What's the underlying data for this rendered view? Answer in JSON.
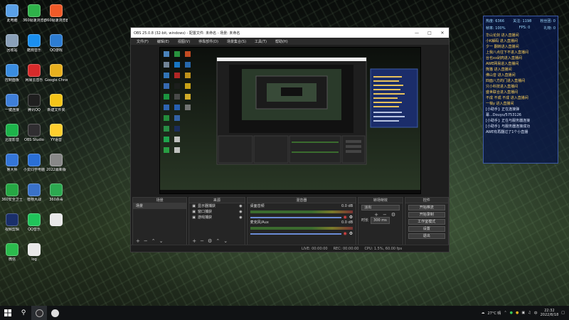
{
  "desktop": {
    "icons": [
      {
        "label": "此电脑",
        "color": "#5aa0e6"
      },
      {
        "label": "360极速浏览器",
        "color": "#2fb34a"
      },
      {
        "label": "360极速浏览器",
        "color": "#f05a28"
      },
      {
        "label": "回收站",
        "color": "#8aa0b8"
      },
      {
        "label": "酷狗音乐",
        "color": "#1a8ff0"
      },
      {
        "label": "QQ游戏",
        "color": "#2d7dd2"
      },
      {
        "label": "控制面板",
        "color": "#3a8de0"
      },
      {
        "label": "网易云音乐",
        "color": "#d82b2b"
      },
      {
        "label": "Google Chrome",
        "color": "#e8b01e"
      },
      {
        "label": "一键连接",
        "color": "#3f7fd8"
      },
      {
        "label": "腾讯QQ",
        "color": "#1f1f1f"
      },
      {
        "label": "新建文件夹",
        "color": "#f5c518"
      },
      {
        "label": "迅雷影音",
        "color": "#1db34a"
      },
      {
        "label": "OBS Studio",
        "color": "#302e31"
      },
      {
        "label": "YY语音",
        "color": "#ffcf2e"
      },
      {
        "label": "鲁大师",
        "color": "#3476d8"
      },
      {
        "label": "小爱同学电脑",
        "color": "#2a6fd6"
      },
      {
        "label": "2022最新版",
        "color": "#888888"
      },
      {
        "label": "360安全卫士",
        "color": "#26a844"
      },
      {
        "label": "植物大战",
        "color": "#3a72c9"
      },
      {
        "label": "360杀毒",
        "color": "#2ca950"
      },
      {
        "label": "视频剪辑",
        "color": "#1a2f6a"
      },
      {
        "label": "QQ音乐",
        "color": "#20c45a"
      },
      {
        "label": "",
        "color": "#e8e8e8"
      },
      {
        "label": "微信",
        "color": "#2bbb4d"
      },
      {
        "label": "log",
        "color": "#e8e8e8"
      }
    ]
  },
  "obs": {
    "title": "OBS 25.0.8 (32-bit, windows) - 配置文件: 未命名 - 场景: 未命名",
    "menu": [
      "文件(F)",
      "编辑(E)",
      "视图(V)",
      "停靠部件(D)",
      "场景集合(S)",
      "工具(T)",
      "帮助(H)"
    ],
    "docks": {
      "scenes": {
        "title": "场景",
        "items": [
          "场景"
        ]
      },
      "sources": {
        "title": "来源",
        "items": [
          "显示器捕获",
          "窗口捕获",
          "游戏捕获"
        ]
      },
      "mixer": {
        "title": "混音器",
        "channels": [
          {
            "name": "桌面音频",
            "db": "0.0 dB"
          },
          {
            "name": "麦克风/Aux",
            "db": "0.0 dB"
          }
        ]
      },
      "transitions": {
        "title": "转场特效",
        "type": "淡出",
        "duration_label": "时长",
        "duration": "300 ms"
      },
      "controls": {
        "title": "控件",
        "buttons": [
          "开始推流",
          "开始录制",
          "工作室模式",
          "设置",
          "退出"
        ]
      }
    },
    "status": {
      "live": "LIVE: 00:00:00",
      "rec": "REC: 00:00:00",
      "cpu": "CPU: 1.5%, 60.00 fps"
    }
  },
  "chat": {
    "stats": [
      {
        "k": "热度",
        "v": "6366"
      },
      {
        "k": "关注",
        "v": "1198"
      },
      {
        "k": "粉丝团",
        "v": "0"
      },
      {
        "k": "帧率",
        "v": "100%"
      },
      {
        "k": "FPS",
        "v": "0"
      },
      {
        "k": "礼物",
        "v": "0"
      }
    ],
    "messages": [
      {
        "t": "华山论剑  进入直播间",
        "c": "y"
      },
      {
        "t": "小K解码 进入直播间",
        "c": "y"
      },
      {
        "t": "夕一 翻转进入直播间",
        "c": "y"
      },
      {
        "t": "上我八点往下不进入直播间",
        "c": "y"
      },
      {
        "t": "台也xx剁肉进入直播间",
        "c": "y"
      },
      {
        "t": "AWE网易进入直播间",
        "c": "y"
      },
      {
        "t": "熊猫  进入直播间",
        "c": "y"
      },
      {
        "t": "佛山音  进入直播间",
        "c": "y"
      },
      {
        "t": "四面八方的门进入直播间",
        "c": "y"
      },
      {
        "t": "只小科技进入直播间",
        "c": "y"
      },
      {
        "t": "盛世联合进入直播间",
        "c": "y"
      },
      {
        "t": "不成  不成  不成  进入直播间",
        "c": "y"
      },
      {
        "t": "一梢y  进入直播间",
        "c": "y"
      },
      {
        "t": "[小助手]:  正在连接弹",
        "c": "w"
      },
      {
        "t": "幕...Douyu/5753126",
        "c": "w"
      },
      {
        "t": "[小助手]:  正在与服务器连接",
        "c": "w"
      },
      {
        "t": "[小助手]:  与服务器连接成功",
        "c": "w"
      },
      {
        "t": "AWE有再翻过了1个小直播",
        "c": "w"
      }
    ]
  },
  "taskbar": {
    "weather": "27°C  晴",
    "time": "22:32",
    "date": "2022/8/18",
    "ime": "中"
  }
}
